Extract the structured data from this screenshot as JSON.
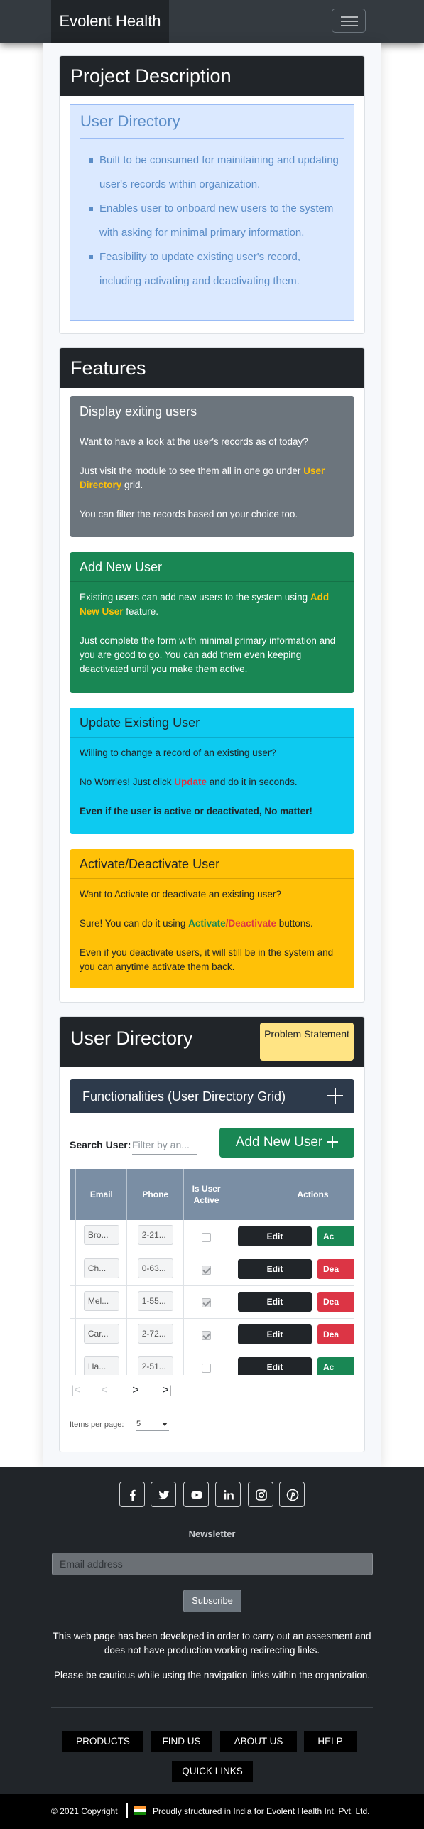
{
  "navbar": {
    "brand": "Evolent Health",
    "toggler_icon": "hamburger-icon"
  },
  "project": {
    "title": "Project Description",
    "box_title": "User Directory",
    "points": [
      "Built to be consumed for mainitaining and updating user's records within organization.",
      "Enables user to onboard new users to the system with asking for minimal primary information.",
      "Feasibility to update existing user's record, including activating and deactivating them."
    ]
  },
  "features": {
    "title": "Features",
    "display": {
      "title": "Display exiting users",
      "p1": "Want to have a look at the user's records as of today?",
      "p2_pre": "Just visit the module to see them all in one go under ",
      "p2_hl": "User Directory",
      "p2_post": " grid.",
      "p3": "You can filter the records based on your choice too."
    },
    "add": {
      "title": "Add New User",
      "p1_pre": "Existing users can add new users to the system using ",
      "p1_hl": "Add New User",
      "p1_post": " feature.",
      "p2": "Just complete the form with minimal primary information and you are good to go. You can add them even keeping deactivated until you make them active."
    },
    "update": {
      "title": "Update Existing User",
      "p1": "Willing to change a record of an existing user?",
      "p2_pre": "No Worries! Just click ",
      "p2_hl": "Update",
      "p2_post": " and do it in seconds.",
      "p3": "Even if the user is active or deactivated, No matter!"
    },
    "activate": {
      "title": "Activate/Deactivate User",
      "p1": "Want to Activate or deactivate an existing user?",
      "p2_pre": "Sure! You can do it using ",
      "p2_hl1": "Activate",
      "p2_sep": "/",
      "p2_hl2": "Deactivate",
      "p2_post": " buttons.",
      "p3": "Even if you deactivate users, it will still be in the system and you can anytime activate them back."
    },
    "colors": {
      "display": "#6c757d",
      "add": "#198754",
      "update": "#0dcaf0",
      "activate": "#ffc107"
    }
  },
  "directory": {
    "title": "User Directory",
    "problem_btn": "Problem Statement",
    "functionalities": "Functionalities (User Directory Grid)",
    "search_label": "Search User:",
    "search_placeholder": "Filter by an...",
    "add_btn": "Add New User",
    "columns": {
      "email": "Email",
      "phone": "Phone",
      "active": "Is User Active",
      "actions": "Actions"
    },
    "rows": [
      {
        "email": "Bro...",
        "phone": "2-21...",
        "active": false,
        "edit": "Edit",
        "state": "Ac"
      },
      {
        "email": "Ch...",
        "phone": "0-63...",
        "active": true,
        "edit": "Edit",
        "state": "Dea"
      },
      {
        "email": "Mel...",
        "phone": "1-55...",
        "active": true,
        "edit": "Edit",
        "state": "Dea"
      },
      {
        "email": "Car...",
        "phone": "2-72...",
        "active": true,
        "edit": "Edit",
        "state": "Dea"
      },
      {
        "email": "Ha...",
        "phone": "2-51...",
        "active": false,
        "edit": "Edit",
        "state": "Ac"
      }
    ],
    "pager": {
      "first": "|<",
      "prev": "<",
      "next": ">",
      "last": ">|"
    },
    "items_per_page_label": "Items per page:",
    "items_per_page": "5"
  },
  "footer": {
    "social_icons": [
      "facebook-icon",
      "twitter-icon",
      "youtube-icon",
      "linkedin-icon",
      "instagram-icon",
      "pinterest-icon"
    ],
    "newsletter": "Newsletter",
    "email_placeholder": "Email address",
    "subscribe": "Subscribe",
    "note1": "This web page has been developed in order to carry out an assesment and does not have production working redirecting links.",
    "note2": "Please be cautious while using the navigation links within the organization.",
    "links": [
      "PRODUCTS",
      "FIND US",
      "ABOUT US",
      "HELP",
      "QUICK LINKS"
    ],
    "copyright": "© 2021 Copyright",
    "credit": "Proudly structured in India for Evolent Health Int. Pvt. Ltd."
  }
}
